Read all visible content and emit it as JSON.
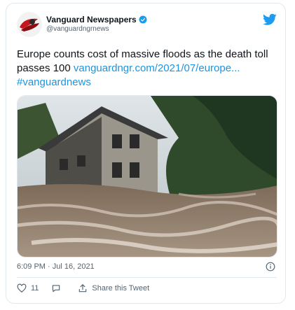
{
  "tweet": {
    "author_name": "Vanguard Newspapers",
    "author_handle": "@vanguardngrnews",
    "text_main": "Europe counts cost of massive floods as the death toll passes 100 ",
    "link_text": "vanguardngr.com/2021/07/europe...",
    "hashtag": "#vanguardnews",
    "timestamp": "6:09 PM · Jul 16, 2021",
    "like_count": "11",
    "share_label": "Share this Tweet"
  },
  "icons": {
    "brand": "twitter-bird-icon",
    "verified": "verified-badge-icon",
    "info": "info-icon",
    "like": "heart-icon",
    "reply": "reply-bubble-icon",
    "share": "share-icon"
  },
  "colors": {
    "link": "#1b95e0",
    "twitter_blue": "#1d9bf0",
    "muted": "#536471",
    "border": "#e1e8ed"
  }
}
